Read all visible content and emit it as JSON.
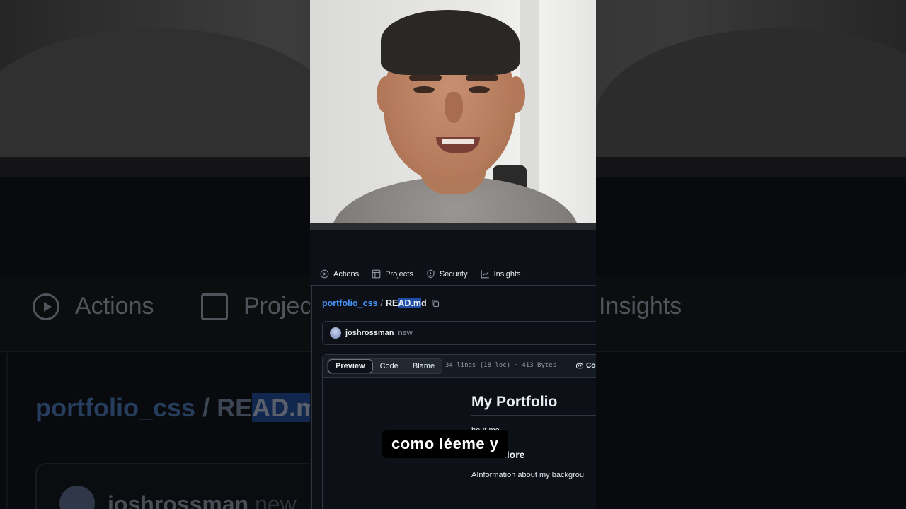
{
  "nav": {
    "items": [
      {
        "label": "Actions",
        "icon": "play-circle-icon"
      },
      {
        "label": "Projects",
        "icon": "table-icon"
      },
      {
        "label": "Security",
        "icon": "shield-icon"
      },
      {
        "label": "Insights",
        "icon": "graph-icon"
      }
    ]
  },
  "breadcrumb": {
    "repo": "portfolio_css",
    "separator": "/",
    "file_pre": "RE",
    "file_highlight": "AD.m",
    "file_post": "d"
  },
  "commit": {
    "user": "joshrossman",
    "message": "new"
  },
  "file": {
    "tabs": [
      "Preview",
      "Code",
      "Blame"
    ],
    "active_tab": "Preview",
    "meta": "34 lines (18 loc) · 413 Bytes",
    "copilot_label": "Cod"
  },
  "readme": {
    "title": "My Portfolio",
    "intro_visible": "bout me.",
    "subheading": "Learn More",
    "body": "AInformation about my backgrou"
  },
  "caption": "como léeme y",
  "background": {
    "nav_actions": "Actions",
    "nav_projects": "Projec",
    "nav_insights": "Insights",
    "crumb_repo": "portfolio_css",
    "crumb_sep": "/",
    "crumb_file_pre": "RE",
    "crumb_file_hl": "AD.m",
    "user": "joshrossman",
    "msg": "new"
  },
  "colors": {
    "link": "#4493f8",
    "canvas": "#0d1117",
    "border": "#30363d",
    "selection": "#1f4fa8"
  }
}
